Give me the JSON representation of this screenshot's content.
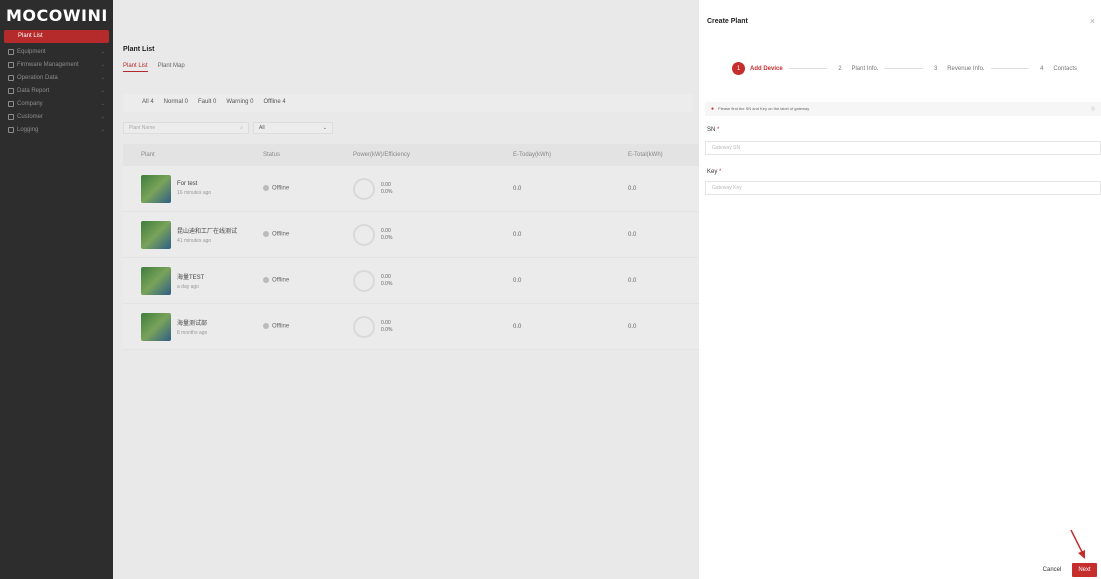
{
  "sidebar": {
    "logo": "MOCOWINI",
    "active_item": "Plant List",
    "items": [
      {
        "label": "Equipment"
      },
      {
        "label": "Firmware Management"
      },
      {
        "label": "Operation Data"
      },
      {
        "label": "Data Report"
      },
      {
        "label": "Company"
      },
      {
        "label": "Customer"
      },
      {
        "label": "Logging"
      }
    ]
  },
  "main": {
    "title": "Plant List",
    "tabs": [
      "Plant List",
      "Plant Map"
    ],
    "filters": [
      "All 4",
      "Normal 0",
      "Fault 0",
      "Warning 0",
      "Offline 4"
    ],
    "search_placeholder": "Plant Name",
    "select_value": "All",
    "columns": [
      "Plant",
      "Status",
      "Power(kW)/Efficiency",
      "E-Today(kWh)",
      "E-Total(kWh)"
    ],
    "rows": [
      {
        "name": "For test",
        "time": "16 minutes ago",
        "status": "Offline",
        "power": "0.00",
        "eff": "0.0%",
        "today": "0.0",
        "total": "0.0"
      },
      {
        "name": "昆山迪和工厂在线测试",
        "time": "41 minutes ago",
        "status": "Offline",
        "power": "0.00",
        "eff": "0.0%",
        "today": "0.0",
        "total": "0.0"
      },
      {
        "name": "海量TEST",
        "time": "a day ago",
        "status": "Offline",
        "power": "0.00",
        "eff": "0.0%",
        "today": "0.0",
        "total": "0.0"
      },
      {
        "name": "海量测试部",
        "time": "8 months ago",
        "status": "Offline",
        "power": "0.00",
        "eff": "0.0%",
        "today": "0.0",
        "total": "0.0"
      }
    ]
  },
  "drawer": {
    "title": "Create Plant",
    "steps": [
      {
        "num": "1",
        "label": "Add Device"
      },
      {
        "num": "2",
        "label": "Plant Info."
      },
      {
        "num": "3",
        "label": "Revenue Info."
      },
      {
        "num": "4",
        "label": "Contacts"
      }
    ],
    "notice": "Please find the SN and Key on the label of gateway",
    "sn_label": "SN",
    "sn_placeholder": "Gateway SN",
    "key_label": "Key",
    "key_placeholder": "Gateway Key",
    "cancel_label": "Cancel",
    "next_label": "Next"
  },
  "colors": {
    "accent": "#c62e2e",
    "sidebar": "#2d2d2d"
  }
}
